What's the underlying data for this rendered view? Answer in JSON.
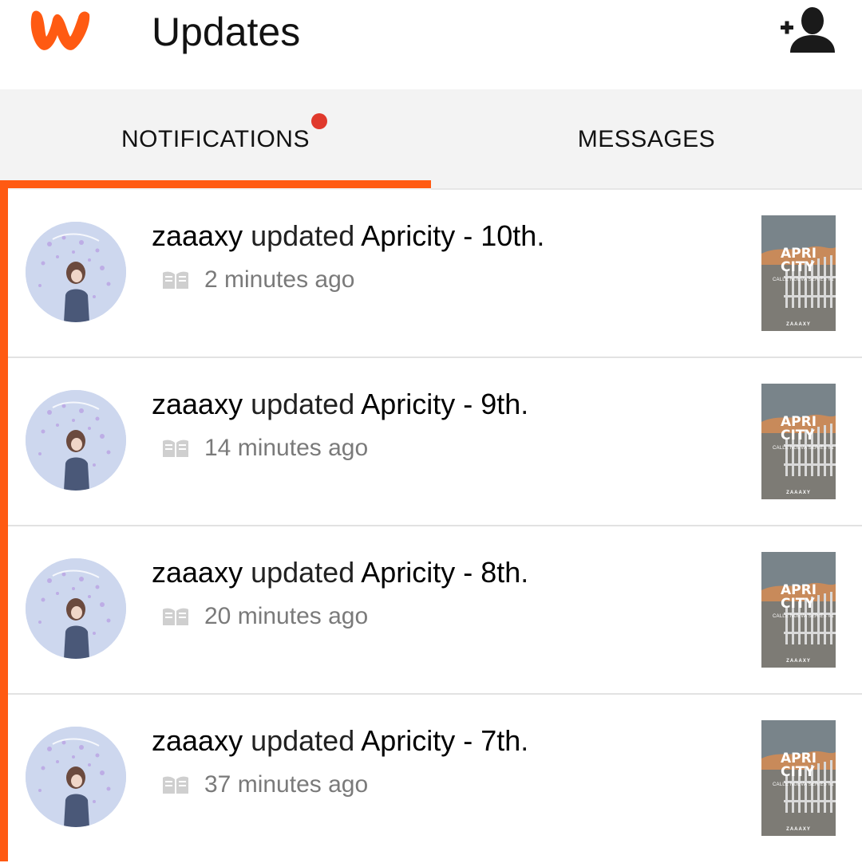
{
  "header": {
    "title": "Updates",
    "logo_icon": "wattpad-logo-icon",
    "action_icon": "add-user-icon",
    "accent_color": "#ff5a12"
  },
  "tabs": [
    {
      "label": "NOTIFICATIONS",
      "active": true,
      "has_badge": true
    },
    {
      "label": "MESSAGES",
      "active": false,
      "has_badge": false
    }
  ],
  "notifications": [
    {
      "username": "zaaaxy",
      "verb": " updated ",
      "story": "Apricity - 10th",
      "suffix": ".",
      "time": "2 minutes ago",
      "cover": {
        "title_line1": "APRI",
        "title_line2": "CITY",
        "subtitle": "CALLE NUEVA SERIES #1",
        "author": "ZAAAXY"
      }
    },
    {
      "username": "zaaaxy",
      "verb": " updated ",
      "story": "Apricity - 9th",
      "suffix": ".",
      "time": "14 minutes ago",
      "cover": {
        "title_line1": "APRI",
        "title_line2": "CITY",
        "subtitle": "CALLE NUEVA SERIES #1",
        "author": "ZAAAXY"
      }
    },
    {
      "username": "zaaaxy",
      "verb": " updated ",
      "story": "Apricity - 8th",
      "suffix": ".",
      "time": "20 minutes ago",
      "cover": {
        "title_line1": "APRI",
        "title_line2": "CITY",
        "subtitle": "CALLE NUEVA SERIES #1",
        "author": "ZAAAXY"
      }
    },
    {
      "username": "zaaaxy",
      "verb": " updated ",
      "story": "Apricity - 7th",
      "suffix": ".",
      "time": "37 minutes ago",
      "cover": {
        "title_line1": "APRI",
        "title_line2": "CITY",
        "subtitle": "CALLE NUEVA SERIES #1",
        "author": "ZAAAXY"
      }
    }
  ]
}
